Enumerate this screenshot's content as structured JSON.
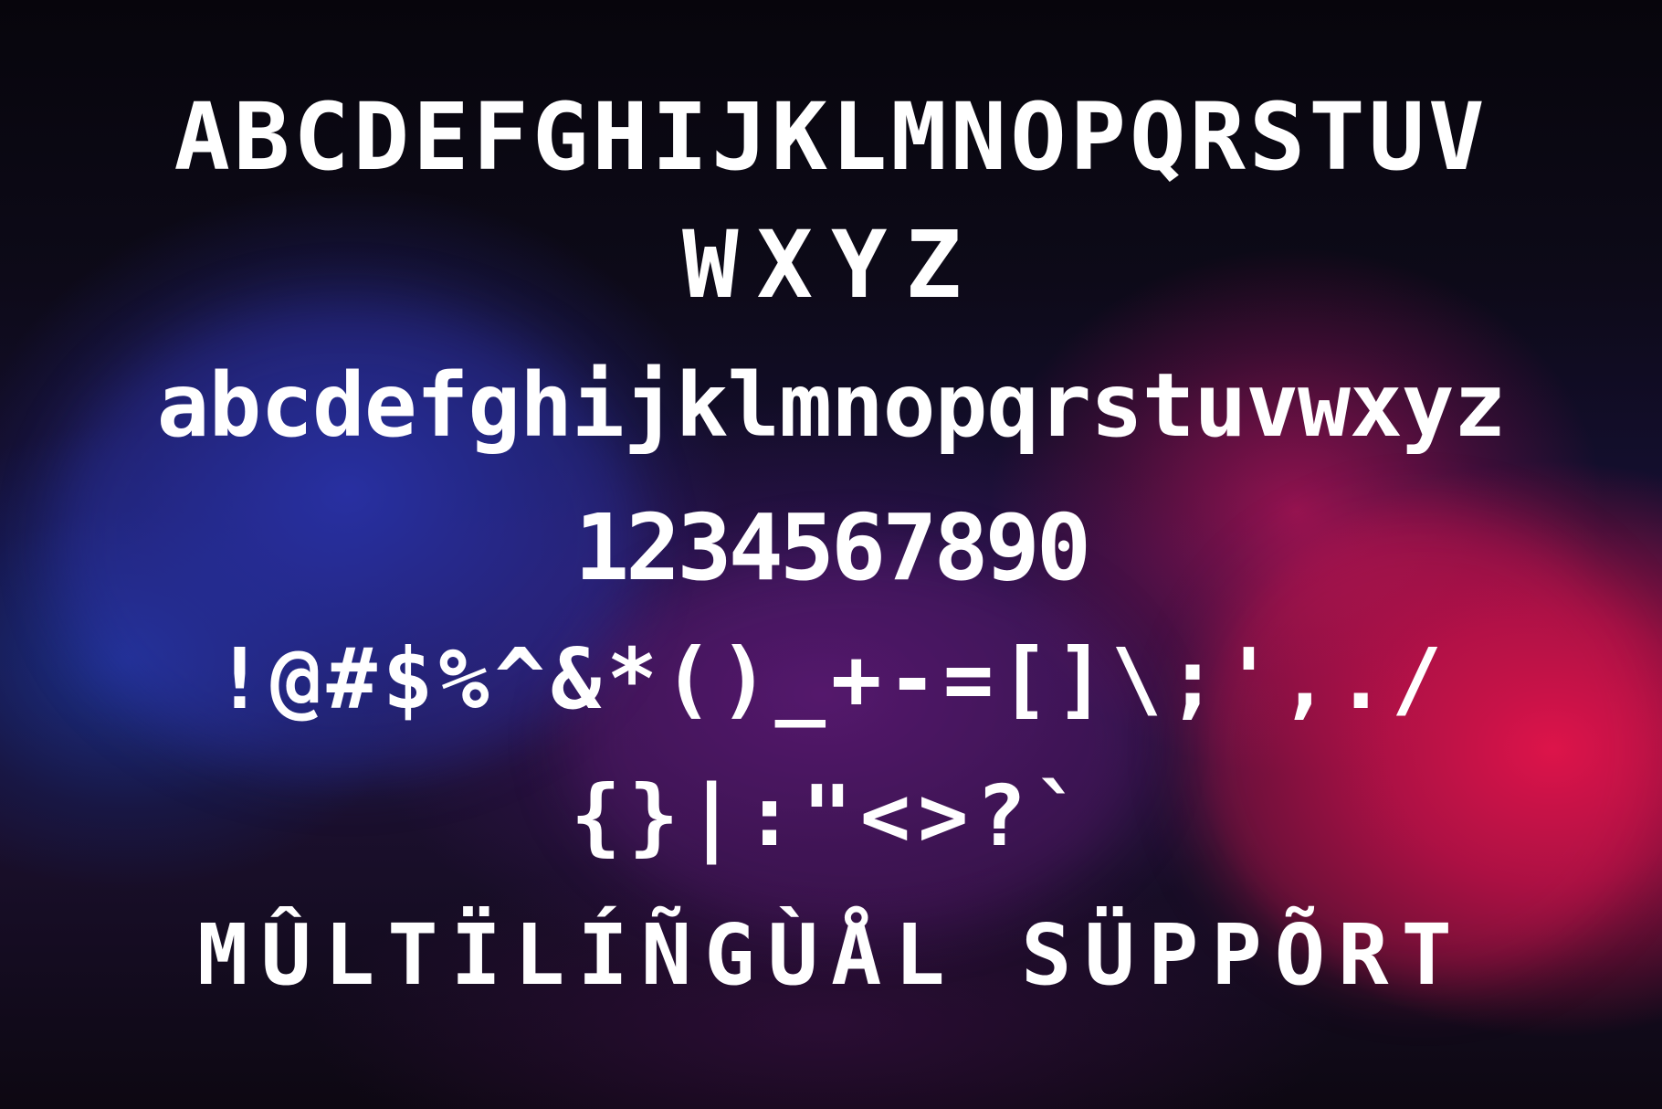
{
  "background": {
    "colors": {
      "top": "#07050c",
      "blue_smoke": "#2b35a8",
      "magenta_smoke": "#a81460",
      "red_smoke": "#e81448"
    }
  },
  "specimen": {
    "uppercase_line1": "ABCDEFGHIJKLMNOPQRSTUV",
    "uppercase_line2": "WXYZ",
    "lowercase": "abcdefghijklmnopqrstuvwxyz",
    "numerals": "1234567890",
    "symbols_line1": "!@#$%^&*()_+-=[]\\;',./",
    "symbols_line2": "{}|:\"<>?`",
    "multilingual": "MÛLTÏLÍÑGÙÅL SÜPPÕRT",
    "text_color": "#ffffff"
  }
}
